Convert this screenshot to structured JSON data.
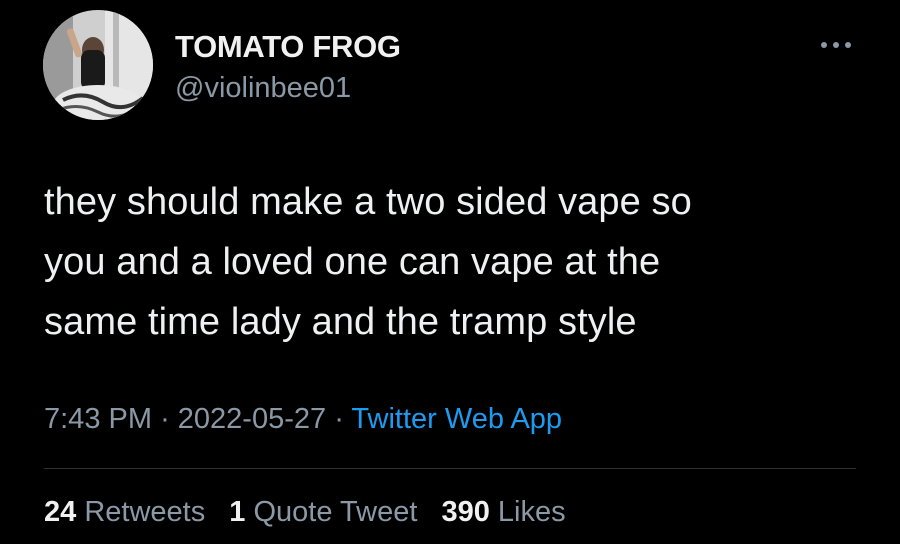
{
  "author": {
    "display_name": "TOMATO FROG",
    "handle": "@violinbee01"
  },
  "icons": {
    "more": "more-horizontal-icon",
    "avatar": "profile-avatar"
  },
  "tweet": {
    "text": "they should make a two sided vape so\nyou and a loved one can vape at the\nsame time lady and the tramp style",
    "time": "7:43 PM",
    "date": "2022-05-27",
    "separator": "·",
    "source": "Twitter Web App"
  },
  "stats": {
    "retweets_count": "24",
    "retweets_label": "Retweets",
    "quotes_count": "1",
    "quotes_label": "Quote Tweet",
    "likes_count": "390",
    "likes_label": "Likes"
  },
  "colors": {
    "background": "#000000",
    "text_primary": "#e7e9ea",
    "text_secondary": "#8b98a5",
    "link": "#1d9bf0",
    "divider": "#2f3336"
  }
}
